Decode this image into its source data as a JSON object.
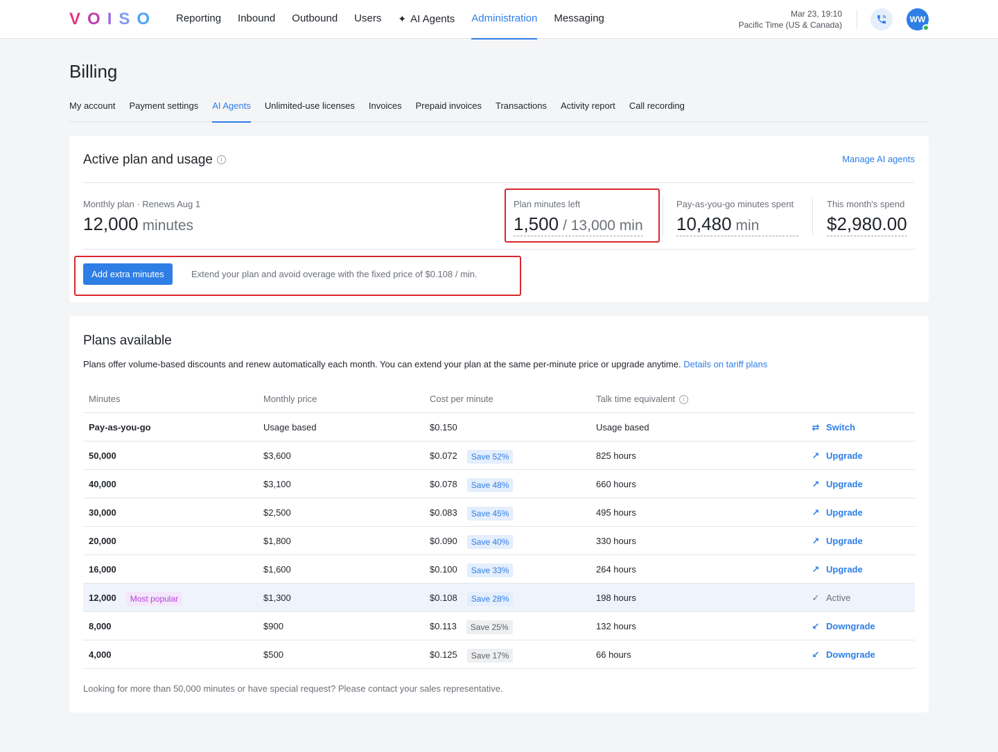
{
  "brand": {
    "letters": [
      "V",
      "O",
      "I",
      "S",
      "O"
    ]
  },
  "nav": {
    "items": [
      {
        "label": "Reporting",
        "name": "nav-reporting"
      },
      {
        "label": "Inbound",
        "name": "nav-inbound"
      },
      {
        "label": "Outbound",
        "name": "nav-outbound"
      },
      {
        "label": "Users",
        "name": "nav-users"
      },
      {
        "label": "AI Agents",
        "name": "nav-ai-agents"
      },
      {
        "label": "Administration",
        "name": "nav-administration"
      },
      {
        "label": "Messaging",
        "name": "nav-messaging"
      }
    ],
    "active_index": 5
  },
  "header": {
    "datetime": "Mar 23, 19:10",
    "timezone": "Pacific Time (US & Canada)",
    "avatar_initials": "WW"
  },
  "page": {
    "title": "Billing",
    "tabs": [
      "My account",
      "Payment settings",
      "AI Agents",
      "Unlimited-use licenses",
      "Invoices",
      "Prepaid invoices",
      "Transactions",
      "Activity report",
      "Call recording"
    ],
    "active_tab_index": 2
  },
  "usage": {
    "title": "Active plan and usage",
    "manage_link": "Manage AI agents",
    "monthly_plan": {
      "label": "Monthly plan · Renews Aug 1",
      "value": "12,000",
      "unit": "minutes"
    },
    "minutes_left": {
      "label": "Plan minutes left",
      "value": "1,500",
      "unit": "/ 13,000 min"
    },
    "payg_spent": {
      "label": "Pay-as-you-go minutes spent",
      "value": "10,480",
      "unit": "min"
    },
    "month_spend": {
      "label": "This month's spend",
      "value": "$2,980.00"
    },
    "add_button": "Add extra minutes",
    "extend_text": "Extend your plan and avoid overage with the fixed price of $0.108 / min."
  },
  "plans": {
    "title": "Plans available",
    "description": "Plans offer volume-based discounts and renew automatically each month. You can extend your plan at the same per-minute price or upgrade anytime.",
    "details_link": "Details on tariff plans",
    "columns": [
      "Minutes",
      "Monthly price",
      "Cost per minute",
      "Talk time equivalent"
    ],
    "rows": [
      {
        "minutes": "Pay-as-you-go",
        "price": "Usage based",
        "cost": "$0.150",
        "save": "",
        "talk": "Usage based",
        "action": "Switch",
        "action_type": "switch"
      },
      {
        "minutes": "50,000",
        "price": "$3,600",
        "cost": "$0.072",
        "save": "Save 52%",
        "save_style": "blue",
        "talk": "825 hours",
        "action": "Upgrade",
        "action_type": "upgrade"
      },
      {
        "minutes": "40,000",
        "price": "$3,100",
        "cost": "$0.078",
        "save": "Save 48%",
        "save_style": "blue",
        "talk": "660 hours",
        "action": "Upgrade",
        "action_type": "upgrade"
      },
      {
        "minutes": "30,000",
        "price": "$2,500",
        "cost": "$0.083",
        "save": "Save 45%",
        "save_style": "blue",
        "talk": "495 hours",
        "action": "Upgrade",
        "action_type": "upgrade"
      },
      {
        "minutes": "20,000",
        "price": "$1,800",
        "cost": "$0.090",
        "save": "Save 40%",
        "save_style": "blue",
        "talk": "330 hours",
        "action": "Upgrade",
        "action_type": "upgrade"
      },
      {
        "minutes": "16,000",
        "price": "$1,600",
        "cost": "$0.100",
        "save": "Save 33%",
        "save_style": "blue",
        "talk": "264 hours",
        "action": "Upgrade",
        "action_type": "upgrade"
      },
      {
        "minutes": "12,000",
        "badge": "Most popular",
        "price": "$1,300",
        "cost": "$0.108",
        "save": "Save 28%",
        "save_style": "blue",
        "talk": "198 hours",
        "action": "Active",
        "action_type": "active"
      },
      {
        "minutes": "8,000",
        "price": "$900",
        "cost": "$0.113",
        "save": "Save 25%",
        "save_style": "grey",
        "talk": "132 hours",
        "action": "Downgrade",
        "action_type": "downgrade"
      },
      {
        "minutes": "4,000",
        "price": "$500",
        "cost": "$0.125",
        "save": "Save 17%",
        "save_style": "grey",
        "talk": "66 hours",
        "action": "Downgrade",
        "action_type": "downgrade"
      }
    ],
    "footnote": "Looking for more than 50,000 minutes or have special request? Please contact your sales representative."
  },
  "colors": {
    "accent": "#2e7ee6",
    "highlight_box": "#d9262c",
    "active_row": "#eef3fc",
    "popular_badge": "#b244d6"
  },
  "icons": {
    "switch": "swap-arrows-icon",
    "upgrade": "arrow-up-right-icon",
    "downgrade": "arrow-down-left-icon",
    "active": "check-icon",
    "phone": "phone-icon",
    "info": "info-icon",
    "spark": "sparkle-icon"
  }
}
